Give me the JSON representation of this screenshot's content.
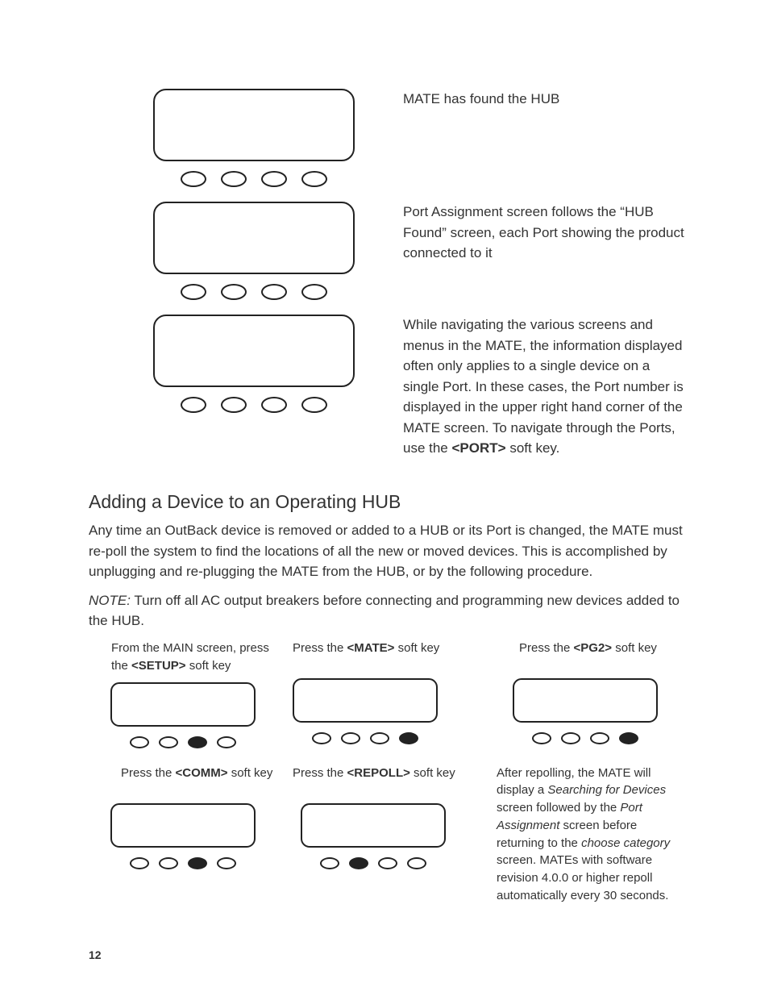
{
  "upper": {
    "caption1": "MATE has found the HUB",
    "caption2": "Port Assignment screen follows the “HUB Found” screen, each Port showing the product connected to it",
    "caption3a": "While navigating the various screens and menus in the MATE, the information displayed often only applies to a single device on a single Port. In these cases, the Port number is displayed in the upper right hand corner of the MATE screen. To navigate through the Ports, use the ",
    "caption3b_key": "<PORT>",
    "caption3c": " soft key."
  },
  "section_heading": "Adding a Device to an Operating HUB",
  "section_body": "Any time an OutBack device is removed or added to a HUB or its Port is changed, the MATE must re-poll the system to find the locations of all the new or moved devices. This is accomplished by unplugging and re-plugging the MATE from the HUB, or by the following procedure.",
  "note_label": "NOTE:",
  "note_text": " Turn off all AC output breakers before connecting and programming new devices added to the HUB.",
  "steps": {
    "s1_a": "From the MAIN screen, press the ",
    "s1_key": "<SETUP>",
    "s1_b": " soft key",
    "s2_a": "Press the ",
    "s2_key": "<MATE>",
    "s2_b": " soft key",
    "s3_a": "Press the ",
    "s3_key": "<PG2>",
    "s3_b": " soft key",
    "s4_a": "Press the ",
    "s4_key": "<COMM>",
    "s4_b": " soft key",
    "s5_a": "Press the ",
    "s5_key": "<REPOLL>",
    "s5_b": " soft key"
  },
  "result": {
    "t1": "After repolling, the MATE will display a ",
    "i1": "Searching for Devices",
    "t2": " screen followed by the ",
    "i2": "Port Assignment",
    "t3": " screen before returning to the ",
    "i3": "choose category",
    "t4": " screen. MATEs with software revision 4.0.0 or higher repoll automatically every 30 seconds."
  },
  "page_number": "12"
}
